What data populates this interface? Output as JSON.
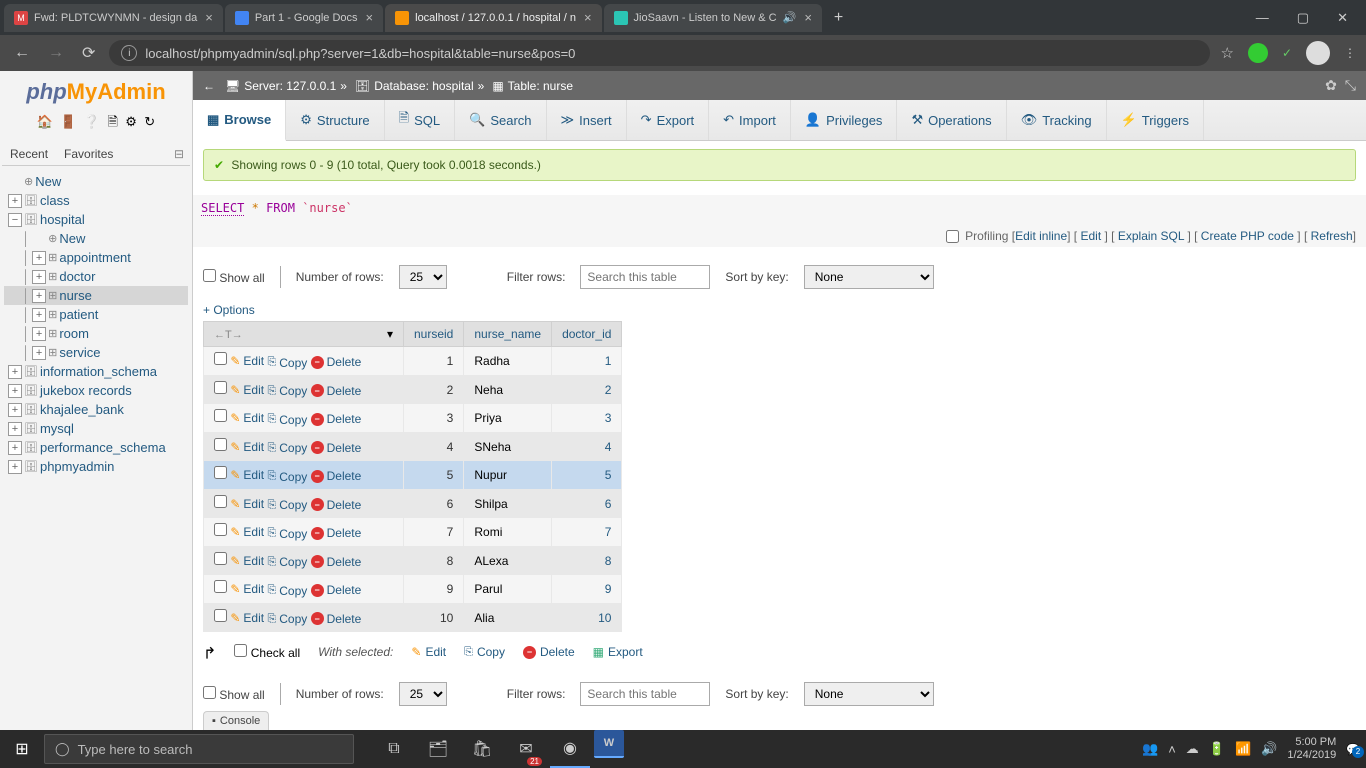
{
  "browser": {
    "tabs": [
      {
        "favicon": "M",
        "title": "Fwd: PLDTCWYNMN - design da"
      },
      {
        "favicon": "D",
        "title": "Part 1 - Google Docs"
      },
      {
        "favicon": "pma",
        "title": "localhost / 127.0.0.1 / hospital / n"
      },
      {
        "favicon": "J",
        "title": "JioSaavn - Listen to New & C"
      }
    ],
    "url": "localhost/phpmyadmin/sql.php?server=1&db=hospital&table=nurse&pos=0"
  },
  "sidebar": {
    "logo": {
      "php": "php",
      "my": "My",
      "admin": "Admin"
    },
    "recent": "Recent",
    "favorites": "Favorites",
    "tree": [
      {
        "label": "New",
        "level": 0,
        "pm": "",
        "icon": "⊕"
      },
      {
        "label": "class",
        "level": 0,
        "pm": "+",
        "icon": "🗄"
      },
      {
        "label": "hospital",
        "level": 0,
        "pm": "−",
        "icon": "🗄",
        "expanded": true
      },
      {
        "label": "New",
        "level": 1,
        "pm": "",
        "icon": "⊕"
      },
      {
        "label": "appointment",
        "level": 1,
        "pm": "+",
        "icon": "⊞"
      },
      {
        "label": "doctor",
        "level": 1,
        "pm": "+",
        "icon": "⊞"
      },
      {
        "label": "nurse",
        "level": 1,
        "pm": "+",
        "icon": "⊞",
        "selected": true
      },
      {
        "label": "patient",
        "level": 1,
        "pm": "+",
        "icon": "⊞"
      },
      {
        "label": "room",
        "level": 1,
        "pm": "+",
        "icon": "⊞"
      },
      {
        "label": "service",
        "level": 1,
        "pm": "+",
        "icon": "⊞"
      },
      {
        "label": "information_schema",
        "level": 0,
        "pm": "+",
        "icon": "🗄"
      },
      {
        "label": "jukebox records",
        "level": 0,
        "pm": "+",
        "icon": "🗄"
      },
      {
        "label": "khajalee_bank",
        "level": 0,
        "pm": "+",
        "icon": "🗄"
      },
      {
        "label": "mysql",
        "level": 0,
        "pm": "+",
        "icon": "🗄"
      },
      {
        "label": "performance_schema",
        "level": 0,
        "pm": "+",
        "icon": "🗄"
      },
      {
        "label": "phpmyadmin",
        "level": 0,
        "pm": "+",
        "icon": "🗄"
      }
    ]
  },
  "breadcrumb": {
    "server_label": "Server: 127.0.0.1",
    "db_label": "Database: hospital",
    "table_label": "Table: nurse"
  },
  "tabs": [
    "Browse",
    "Structure",
    "SQL",
    "Search",
    "Insert",
    "Export",
    "Import",
    "Privileges",
    "Operations",
    "Tracking",
    "Triggers"
  ],
  "result": {
    "msg": "Showing rows 0 - 9 (10 total, Query took 0.0018 seconds.)",
    "sql": {
      "select": "SELECT",
      "star": "*",
      "from": "FROM",
      "table": "`nurse`"
    }
  },
  "sql_actions": {
    "profiling": "Profiling",
    "links": [
      "Edit inline",
      "Edit",
      "Explain SQL",
      "Create PHP code",
      "Refresh"
    ]
  },
  "filter": {
    "show_all": "Show all",
    "num_rows_label": "Number of rows:",
    "num_rows_value": "25",
    "filter_label": "Filter rows:",
    "filter_placeholder": "Search this table",
    "sort_label": "Sort by key:",
    "sort_value": "None"
  },
  "options_link": "+ Options",
  "table": {
    "cols": [
      "nurseid",
      "nurse_name",
      "doctor_id"
    ],
    "rows": [
      {
        "nurseid": 1,
        "nurse_name": "Radha",
        "doctor_id": 1
      },
      {
        "nurseid": 2,
        "nurse_name": "Neha",
        "doctor_id": 2
      },
      {
        "nurseid": 3,
        "nurse_name": "Priya",
        "doctor_id": 3
      },
      {
        "nurseid": 4,
        "nurse_name": "SNeha",
        "doctor_id": 4
      },
      {
        "nurseid": 5,
        "nurse_name": "Nupur",
        "doctor_id": 5,
        "hover": true
      },
      {
        "nurseid": 6,
        "nurse_name": "Shilpa",
        "doctor_id": 6
      },
      {
        "nurseid": 7,
        "nurse_name": "Romi",
        "doctor_id": 7
      },
      {
        "nurseid": 8,
        "nurse_name": "ALexa",
        "doctor_id": 8
      },
      {
        "nurseid": 9,
        "nurse_name": "Parul",
        "doctor_id": 9
      },
      {
        "nurseid": 10,
        "nurse_name": "Alia",
        "doctor_id": 10
      }
    ],
    "actions": {
      "edit": "Edit",
      "copy": "Copy",
      "delete": "Delete"
    }
  },
  "checkall": {
    "label": "Check all",
    "with_selected": "With selected:",
    "actions": [
      "Edit",
      "Copy",
      "Delete",
      "Export"
    ]
  },
  "console": "Console",
  "taskbar": {
    "search_placeholder": "Type here to search",
    "clock_time": "5:00 PM",
    "clock_date": "1/24/2019",
    "mail_badge": "21",
    "notif_count": "2"
  }
}
